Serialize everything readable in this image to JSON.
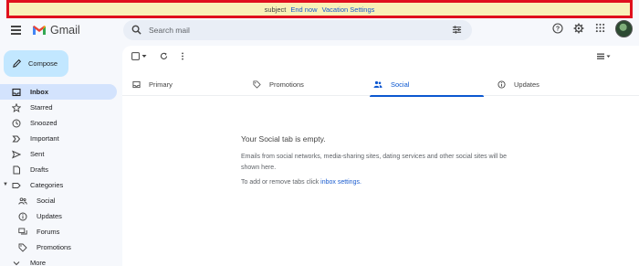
{
  "banner": {
    "subject": "subject",
    "end_now": "End now",
    "settings": "Vacation Settings"
  },
  "header": {
    "logo_text": "Gmail",
    "search_placeholder": "Search mail"
  },
  "sidebar": {
    "compose_label": "Compose",
    "items": [
      {
        "label": "Inbox",
        "icon": "inbox-icon"
      },
      {
        "label": "Starred",
        "icon": "star-icon"
      },
      {
        "label": "Snoozed",
        "icon": "clock-icon"
      },
      {
        "label": "Important",
        "icon": "important-icon"
      },
      {
        "label": "Sent",
        "icon": "send-icon"
      },
      {
        "label": "Drafts",
        "icon": "draft-icon"
      },
      {
        "label": "Categories",
        "icon": "label-icon"
      },
      {
        "label": "Social",
        "icon": "people-icon"
      },
      {
        "label": "Updates",
        "icon": "info-icon"
      },
      {
        "label": "Forums",
        "icon": "forum-icon"
      },
      {
        "label": "Promotions",
        "icon": "tag-icon"
      },
      {
        "label": "More",
        "icon": "chevron-down-icon"
      }
    ]
  },
  "tabs": [
    {
      "label": "Primary",
      "icon": "inbox-icon"
    },
    {
      "label": "Promotions",
      "icon": "tag-icon"
    },
    {
      "label": "Social",
      "icon": "people-icon"
    },
    {
      "label": "Updates",
      "icon": "info-icon"
    }
  ],
  "empty_state": {
    "title": "Your Social tab is empty.",
    "description": "Emails from social networks, media-sharing sites, dating services and other social sites will be shown here.",
    "hint_prefix": "To add or remove tabs click",
    "hint_link": "inbox settings."
  },
  "colors": {
    "accent": "#0b57d0",
    "compose_bg": "#c2e7ff",
    "active_nav_bg": "#d3e3fd",
    "banner_bg": "#f9f1b8",
    "banner_border": "#e0101e"
  }
}
